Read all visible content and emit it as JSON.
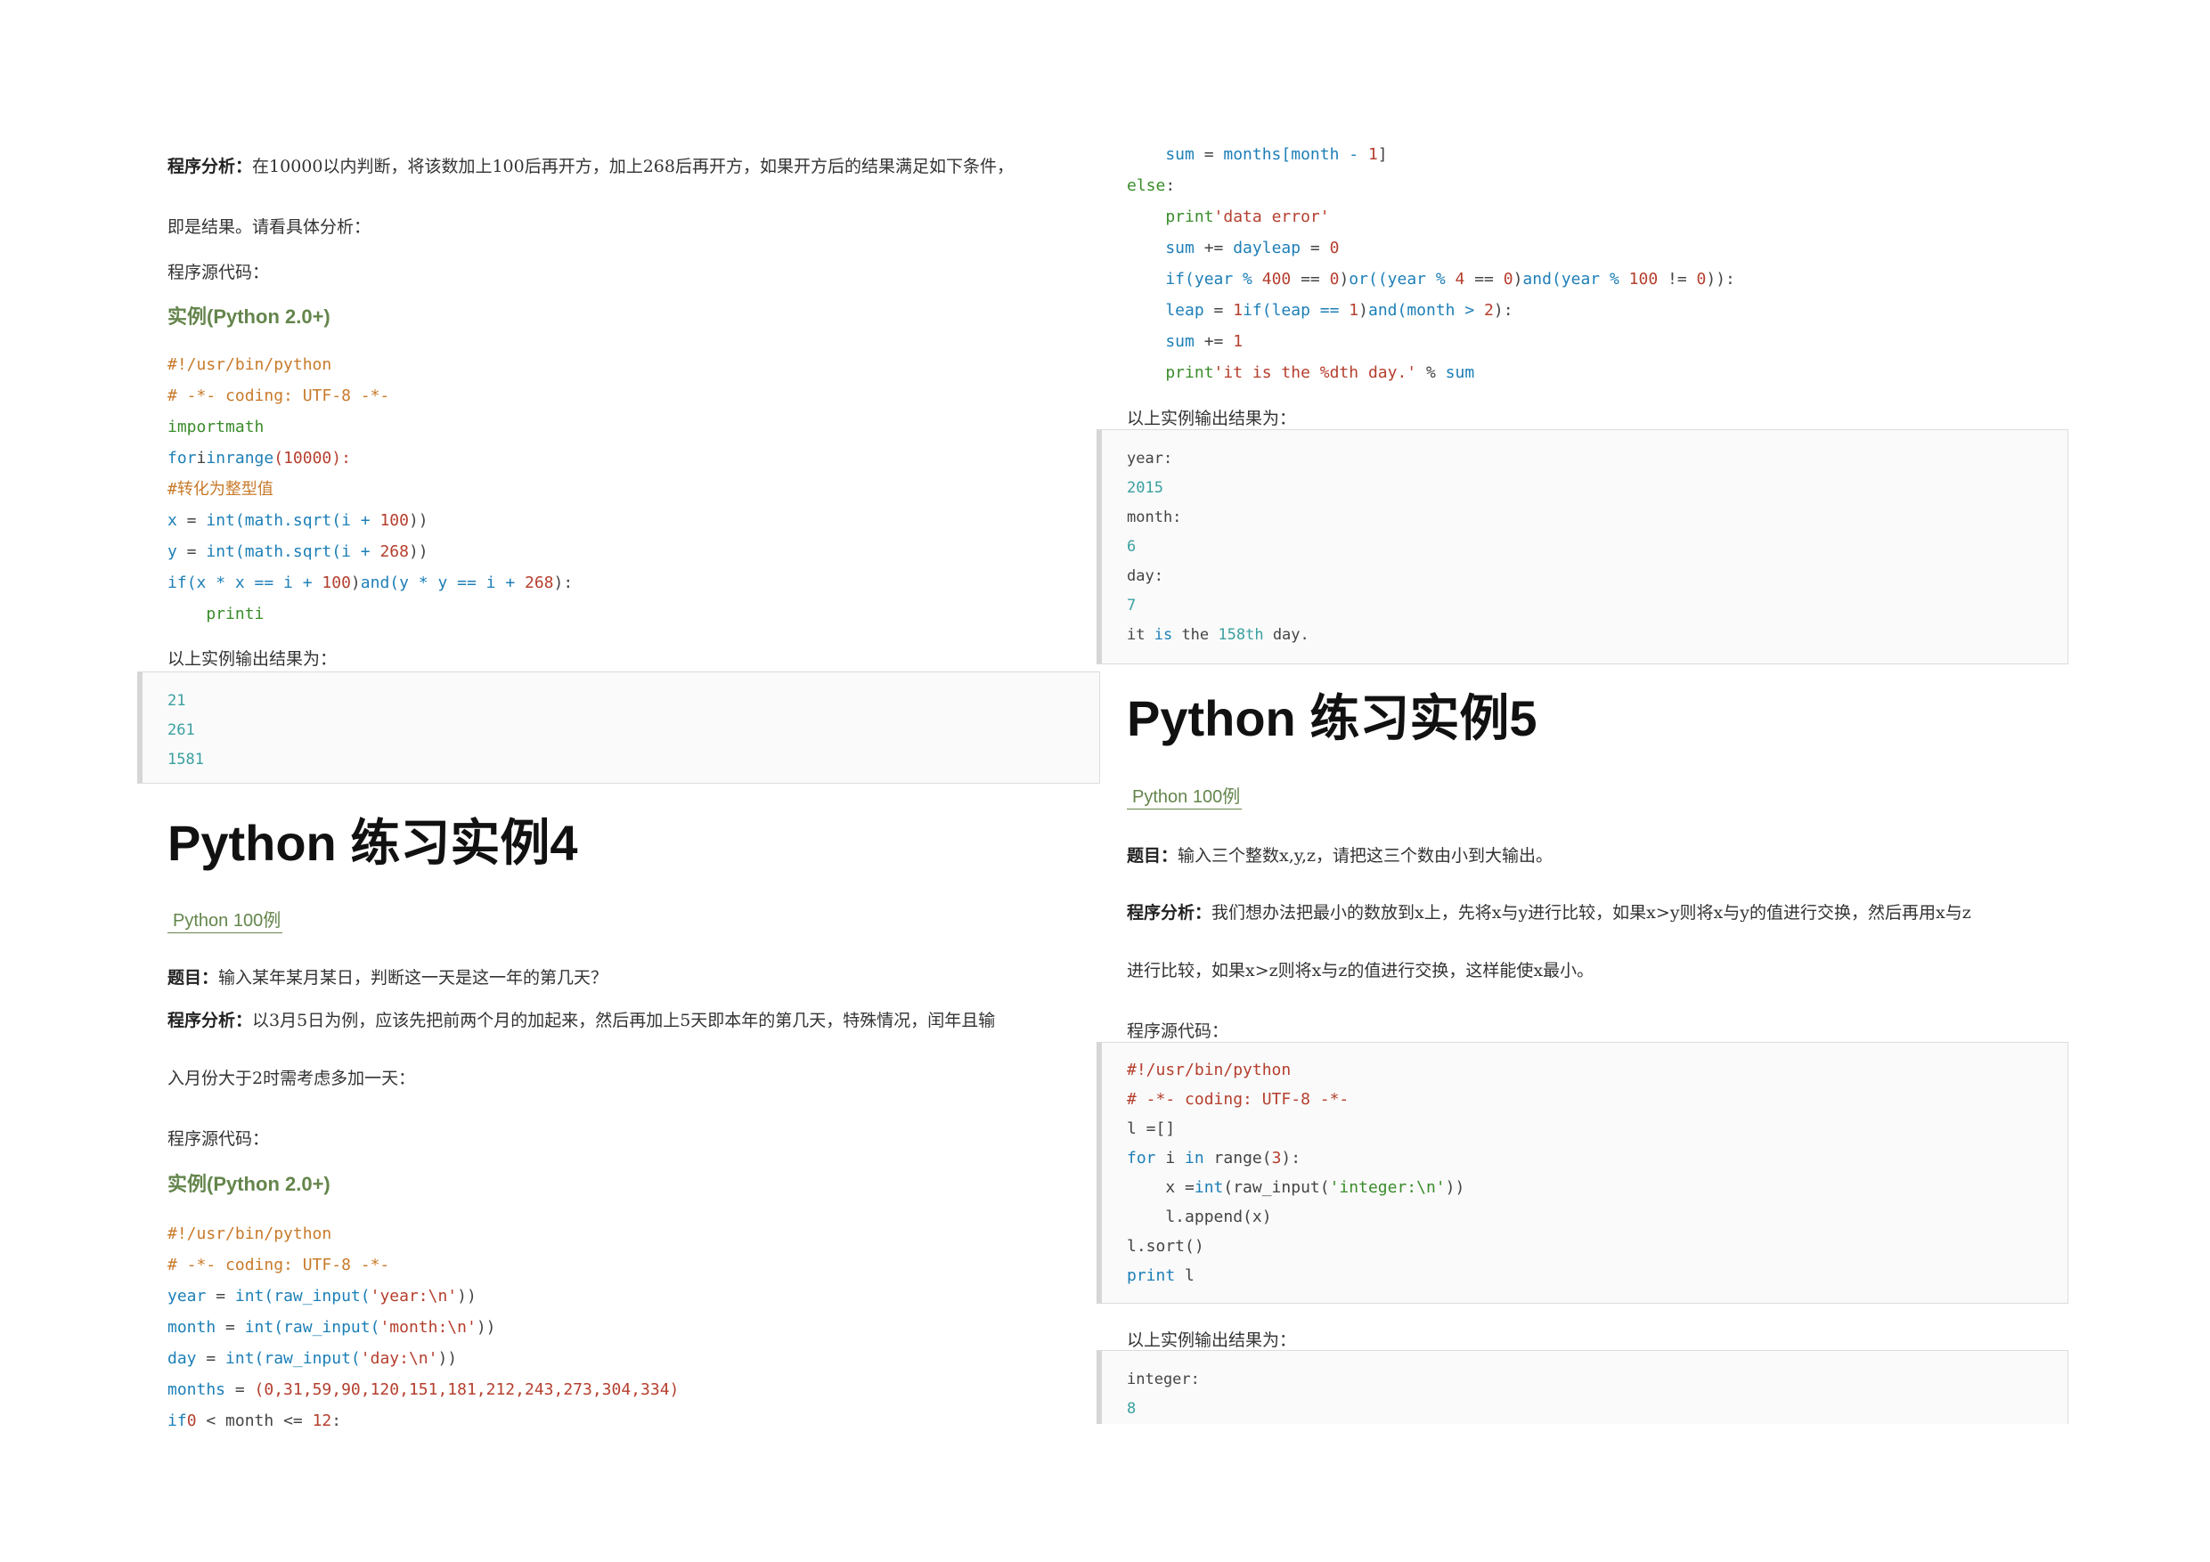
{
  "left": {
    "analysis_label": "程序分析：",
    "analysis_l1": "在10000以内判断，将该数加上100后再开方，加上268后再开方，如果开方后的结果满足如下条件，",
    "analysis_l2": "即是结果。请看具体分析：",
    "source_label": "程序源代码：",
    "example_label": "实例(Python 2.0+)",
    "code": [
      [
        [
          "#!/usr/bin/python",
          "c"
        ]
      ],
      [
        [
          "# -*- coding: UTF-8 -*-",
          "c"
        ]
      ],
      [
        [
          "import",
          "g"
        ],
        [
          "math",
          "g"
        ]
      ],
      [
        [
          "for",
          "k"
        ],
        [
          "i",
          "t"
        ],
        [
          "in",
          "k"
        ],
        [
          "range",
          "k"
        ],
        [
          "(10000):",
          "s"
        ]
      ],
      [
        [
          "#转化为整型值",
          "c"
        ]
      ],
      [
        [
          "x",
          "k"
        ],
        [
          " = ",
          "t"
        ],
        [
          "int",
          "k"
        ],
        [
          "(math.sqrt(i + ",
          "k"
        ],
        [
          "100",
          "s"
        ],
        [
          "))",
          "t"
        ]
      ],
      [
        [
          "y",
          "k"
        ],
        [
          " = ",
          "t"
        ],
        [
          "int",
          "k"
        ],
        [
          "(math.sqrt(i + ",
          "k"
        ],
        [
          "268",
          "s"
        ],
        [
          "))",
          "t"
        ]
      ],
      [
        [
          "if",
          "k"
        ],
        [
          "(x * x == i + ",
          "k"
        ],
        [
          "100",
          "s"
        ],
        [
          ")",
          "t"
        ],
        [
          "and",
          "k"
        ],
        [
          "(y * y == i + ",
          "k"
        ],
        [
          "268",
          "s"
        ],
        [
          "):",
          "t"
        ]
      ],
      [
        [
          "    print",
          "g"
        ],
        [
          "i",
          "g"
        ]
      ]
    ],
    "output_label": "以上实例输出结果为：",
    "output": [
      [
        "21",
        "n"
      ],
      [
        "261",
        "n"
      ],
      [
        "1581",
        "n"
      ]
    ],
    "ex4_title": "Python 练习实例4",
    "link_text": "Python 100例",
    "q_label": "题目：",
    "q_text": "输入某年某月某日，判断这一天是这一年的第几天？",
    "a_label": "程序分析：",
    "a_l1": "以3月5日为例，应该先把前两个月的加起来，然后再加上5天即本年的第几天，特殊情况，闰年且输",
    "a_l2": "入月份大于2时需考虑多加一天：",
    "source_label2": "程序源代码：",
    "example_label2": "实例(Python 2.0+)",
    "code2": [
      [
        [
          "#!/usr/bin/python",
          "c"
        ]
      ],
      [
        [
          "# -*- coding: UTF-8 -*-",
          "c"
        ]
      ],
      [
        [
          "year",
          "k"
        ],
        [
          " = ",
          "t"
        ],
        [
          "int",
          "k"
        ],
        [
          "(raw_input(",
          "k"
        ],
        [
          "'year:\\n'",
          "s"
        ],
        [
          "))",
          "t"
        ]
      ],
      [
        [
          "month",
          "k"
        ],
        [
          " = ",
          "t"
        ],
        [
          "int",
          "k"
        ],
        [
          "(raw_input(",
          "k"
        ],
        [
          "'month:\\n'",
          "s"
        ],
        [
          "))",
          "t"
        ]
      ],
      [
        [
          "day",
          "k"
        ],
        [
          " = ",
          "t"
        ],
        [
          "int",
          "k"
        ],
        [
          "(raw_input(",
          "k"
        ],
        [
          "'day:\\n'",
          "s"
        ],
        [
          "))",
          "t"
        ]
      ],
      [
        [
          "months",
          "k"
        ],
        [
          " = ",
          "t"
        ],
        [
          "(0,31,59,90,120,151,181,212,243,273,304,334)",
          "s"
        ]
      ],
      [
        [
          "if",
          "k"
        ],
        [
          "0",
          "s"
        ],
        [
          " < month <= ",
          "t"
        ],
        [
          "12",
          "s"
        ],
        [
          ":",
          "t"
        ]
      ]
    ]
  },
  "right": {
    "code": [
      [
        [
          "    sum",
          "k"
        ],
        [
          " = ",
          "t"
        ],
        [
          "months[month - ",
          "k"
        ],
        [
          "1",
          "s"
        ],
        [
          "]",
          "t"
        ]
      ],
      [
        [
          "else",
          "g"
        ],
        [
          ":",
          "t"
        ]
      ],
      [
        [
          "    print",
          "g"
        ],
        [
          "'data error'",
          "s"
        ]
      ],
      [
        [
          "    sum",
          "k"
        ],
        [
          " += ",
          "t"
        ],
        [
          "dayleap",
          "k"
        ],
        [
          " = ",
          "t"
        ],
        [
          "0",
          "s"
        ]
      ],
      [
        [
          "    if",
          "k"
        ],
        [
          "(year % ",
          "k"
        ],
        [
          "400",
          "s"
        ],
        [
          " == ",
          "t"
        ],
        [
          "0",
          "s"
        ],
        [
          ")",
          "t"
        ],
        [
          "or",
          "k"
        ],
        [
          "((year % ",
          "k"
        ],
        [
          "4",
          "s"
        ],
        [
          " == ",
          "t"
        ],
        [
          "0",
          "s"
        ],
        [
          ")",
          "t"
        ],
        [
          "and",
          "k"
        ],
        [
          "(year % ",
          "k"
        ],
        [
          "100",
          "s"
        ],
        [
          " != ",
          "t"
        ],
        [
          "0",
          "s"
        ],
        [
          "))",
          "t"
        ],
        [
          ":",
          "t"
        ]
      ],
      [
        [
          "    leap",
          "k"
        ],
        [
          " = ",
          "t"
        ],
        [
          "1",
          "s"
        ],
        [
          "if",
          "k"
        ],
        [
          "(leap == ",
          "k"
        ],
        [
          "1",
          "s"
        ],
        [
          ")",
          "t"
        ],
        [
          "and",
          "k"
        ],
        [
          "(month > ",
          "k"
        ],
        [
          "2",
          "s"
        ],
        [
          "):",
          "t"
        ]
      ],
      [
        [
          "    sum",
          "k"
        ],
        [
          " += ",
          "t"
        ],
        [
          "1",
          "s"
        ]
      ],
      [
        [
          "    print",
          "g"
        ],
        [
          "'it is the %dth day.'",
          "s"
        ],
        [
          " % ",
          "t"
        ],
        [
          "sum",
          "k"
        ]
      ]
    ],
    "output_label": "以上实例输出结果为：",
    "output": [
      [
        "year:",
        "t"
      ],
      [
        "2015",
        "n"
      ],
      [
        "month:",
        "t"
      ],
      [
        "6",
        "n"
      ],
      [
        "day:",
        "t"
      ],
      [
        "7",
        "n"
      ],
      [
        [
          "it ",
          "t"
        ],
        [
          "is",
          "k"
        ],
        [
          " the ",
          "t"
        ],
        [
          "158th",
          "n"
        ],
        [
          " day.",
          "t"
        ]
      ]
    ],
    "ex5_title": "Python 练习实例5",
    "link_text": "Python 100例",
    "q_label": "题目：",
    "q_text": "输入三个整数x,y,z，请把这三个数由小到大输出。",
    "a_label": "程序分析：",
    "a_l1": "我们想办法把最小的数放到x上，先将x与y进行比较，如果x>y则将x与y的值进行交换，然后再用x与z",
    "a_l2": "进行比较，如果x>z则将x与z的值进行交换，这样能使x最小。",
    "source_label": "程序源代码：",
    "code2": [
      [
        [
          "#!/usr/bin/python",
          "s"
        ]
      ],
      [
        [
          "# -*- coding: UTF-8 -*-",
          "s"
        ]
      ],
      [
        [
          "l =[]",
          "t"
        ]
      ],
      [
        [
          "for",
          "k"
        ],
        [
          " i ",
          "t"
        ],
        [
          "in",
          "k"
        ],
        [
          " range(",
          "t"
        ],
        [
          "3",
          "s"
        ],
        [
          "):",
          "t"
        ]
      ],
      [
        [
          "    x =",
          "t"
        ],
        [
          "int",
          "k"
        ],
        [
          "(raw_input(",
          "t"
        ],
        [
          "'integer:\\n'",
          "g"
        ],
        [
          "))",
          "t"
        ]
      ],
      [
        [
          "    l.append(x)",
          "t"
        ]
      ],
      [
        [
          "l.sort()",
          "t"
        ]
      ],
      [
        [
          "print",
          "k"
        ],
        [
          " l",
          "t"
        ]
      ]
    ],
    "output_label2": "以上实例输出结果为：",
    "output2": [
      [
        "integer:",
        "t"
      ],
      [
        "8",
        "n"
      ]
    ]
  }
}
